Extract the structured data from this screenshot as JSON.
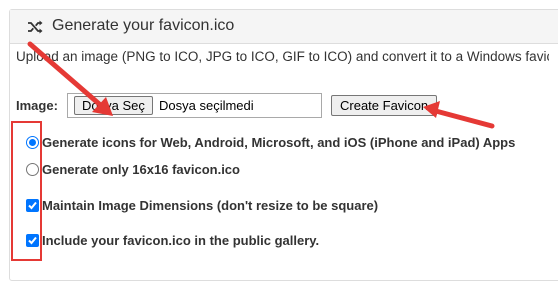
{
  "panel": {
    "title": "Generate your favicon.ico",
    "description": "Upload an image (PNG to ICO, JPG to ICO, GIF to ICO) and convert it to a Windows favicon"
  },
  "form": {
    "image_label": "Image:",
    "file_button_label": "Dosya Seç",
    "file_status": "Dosya seçilmedi",
    "create_button_label": "Create Favicon"
  },
  "options": [
    {
      "label": "Generate icons for Web, Android, Microsoft, and iOS (iPhone and iPad) Apps",
      "type": "radio",
      "checked": true
    },
    {
      "label": "Generate only 16x16 favicon.ico",
      "type": "radio",
      "checked": false
    },
    {
      "label": "Maintain Image Dimensions (don't resize to be square)",
      "type": "checkbox",
      "checked": true
    },
    {
      "label": "Include your favicon.ico in the public gallery.",
      "type": "checkbox",
      "checked": true
    }
  ],
  "icons": {
    "header": "shuffle-icon"
  },
  "colors": {
    "annotation": "#e53935",
    "accent": "#0075ff",
    "header_bg": "#f5f5f5"
  }
}
